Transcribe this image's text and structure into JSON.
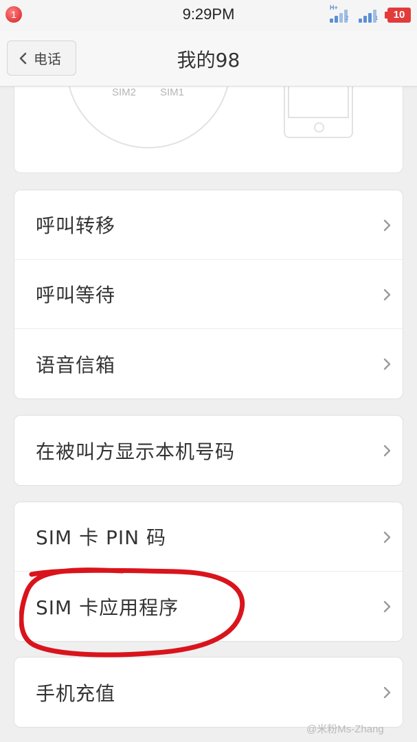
{
  "status_bar": {
    "notification_count": "1",
    "time": "9:29PM",
    "network_type": "H+",
    "sim1_number": "2",
    "sim2_number": "1",
    "battery_level": "10"
  },
  "nav": {
    "back_label": "电话",
    "title": "我的98"
  },
  "sim_diagram": {
    "sim2_label": "SIM2",
    "sim1_label": "SIM1"
  },
  "groups": [
    {
      "items": [
        {
          "label": "呼叫转移"
        },
        {
          "label": "呼叫等待"
        },
        {
          "label": "语音信箱"
        }
      ]
    },
    {
      "items": [
        {
          "label": "在被叫方显示本机号码"
        }
      ]
    },
    {
      "items": [
        {
          "label": "SIM 卡 PIN 码"
        },
        {
          "label": "SIM 卡应用程序"
        }
      ]
    },
    {
      "items": [
        {
          "label": "手机充值"
        }
      ]
    }
  ],
  "watermark": "@米粉Ms-Zhang",
  "colors": {
    "annotation": "#d9141c",
    "battery": "#e23b3b",
    "signal": "#5b8fd6"
  }
}
